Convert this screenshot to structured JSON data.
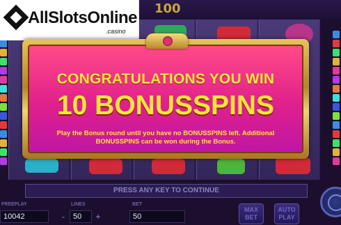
{
  "top_bar": {
    "value": "100"
  },
  "logo": {
    "text": "AllSlotsOnline",
    "sub": ".casino"
  },
  "dialog": {
    "congrats": "CONGRATULATIONS YOU WIN",
    "spins": "10 BONUSSPINS",
    "description": "Play the Bonus round until you have no BONUSSPINS left. Additional BONUSSPINS can be won during the Bonus."
  },
  "prompt": {
    "text": "PRESS ANY KEY TO CONTINUE"
  },
  "controls": {
    "freeplay_label": "FREEPLAY",
    "freeplay_value": "10042",
    "lines_label": "LINES",
    "lines_value": "50",
    "bet_label": "BET",
    "bet_value": "50",
    "minus": "-",
    "plus": "+",
    "max_bet_label": "MAX BET",
    "auto_play_label": "AUTO PLAY"
  },
  "colors": {
    "dialog_text": "#f9e43c",
    "dialog_bg": "#e0208c",
    "frame_gold": "#d8aa45"
  }
}
